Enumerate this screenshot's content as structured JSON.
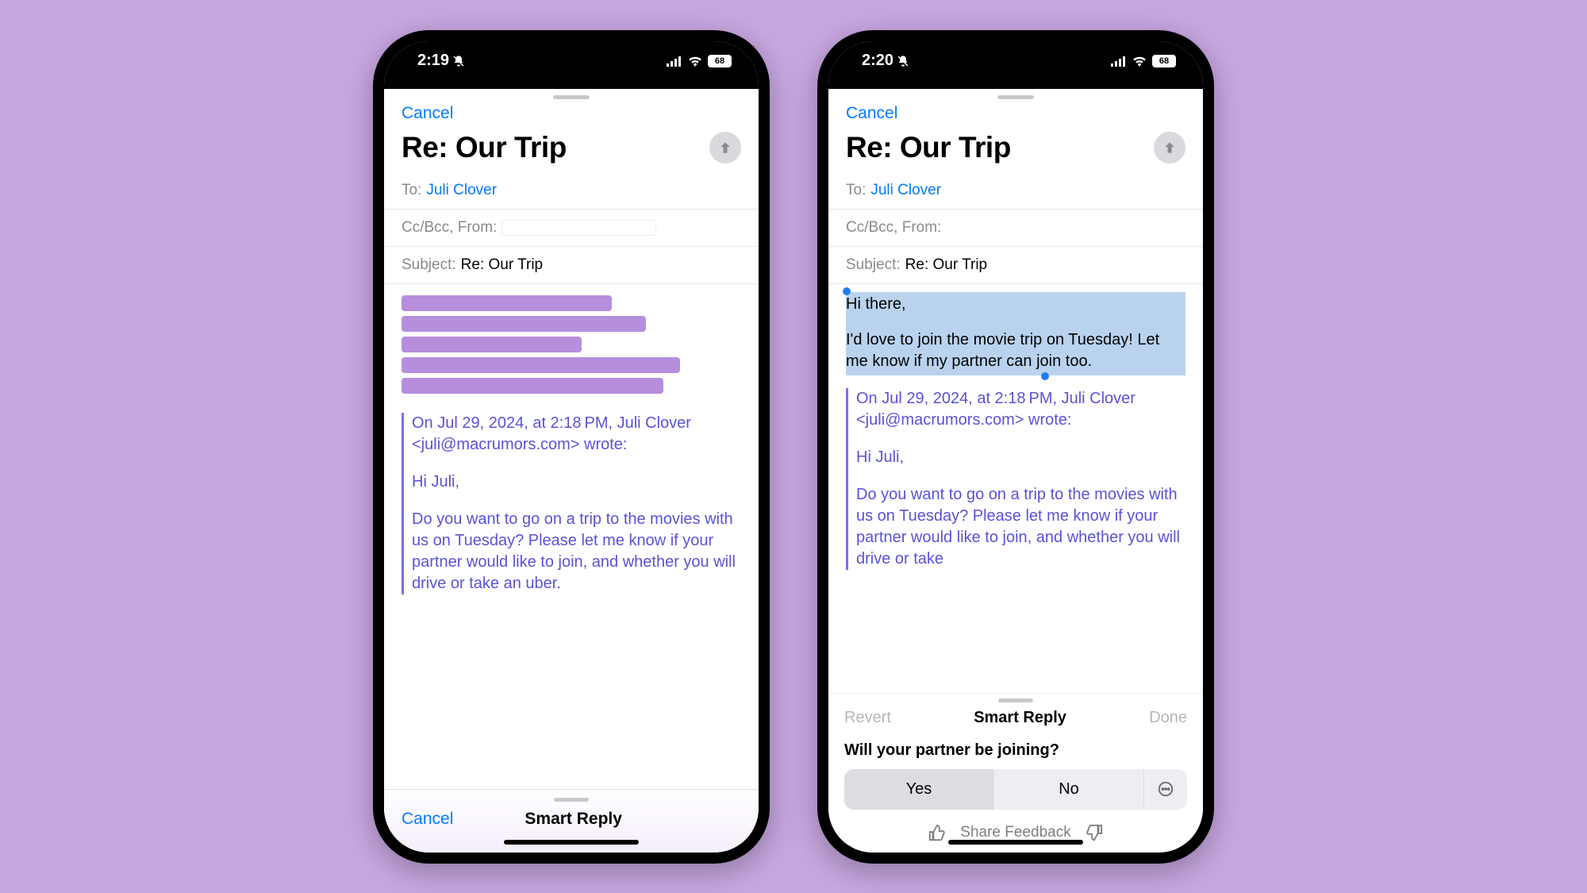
{
  "phone1": {
    "status": {
      "time": "2:19",
      "battery": "68"
    },
    "cancel": "Cancel",
    "title": "Re: Our Trip",
    "to_label": "To:",
    "to_value": "Juli Clover",
    "ccbcc_label": "Cc/Bcc, From:",
    "subject_label": "Subject:",
    "subject_value": "Re: Our Trip",
    "quote_header": "On Jul 29, 2024, at 2:18 PM, Juli Clover <juli@macrumors.com> wrote:",
    "quote_greeting": "Hi Juli,",
    "quote_body": "Do you want to go on a trip to the movies with us on Tuesday? Please let me know if your partner would like to join, and whether you will drive or take an uber.",
    "bottom_cancel": "Cancel",
    "bottom_title": "Smart Reply"
  },
  "phone2": {
    "status": {
      "time": "2:20",
      "battery": "68"
    },
    "cancel": "Cancel",
    "title": "Re: Our Trip",
    "to_label": "To:",
    "to_value": "Juli Clover",
    "ccbcc_label": "Cc/Bcc, From:",
    "subject_label": "Subject:",
    "subject_value": "Re: Our Trip",
    "reply_greeting": "Hi there,",
    "reply_body": "I'd love to join the movie trip on Tuesday! Let me know if my partner can join too.",
    "quote_header": "On Jul 29, 2024, at 2:18 PM, Juli Clover <juli@macrumors.com> wrote:",
    "quote_greeting": "Hi Juli,",
    "quote_body": "Do you want to go on a trip to the movies with us on Tuesday? Please let me know if your partner would like to join, and whether you will drive or take",
    "sr_revert": "Revert",
    "sr_title": "Smart Reply",
    "sr_done": "Done",
    "sr_question": "Will your partner be joining?",
    "sr_yes": "Yes",
    "sr_no": "No",
    "sr_feedback": "Share Feedback"
  }
}
